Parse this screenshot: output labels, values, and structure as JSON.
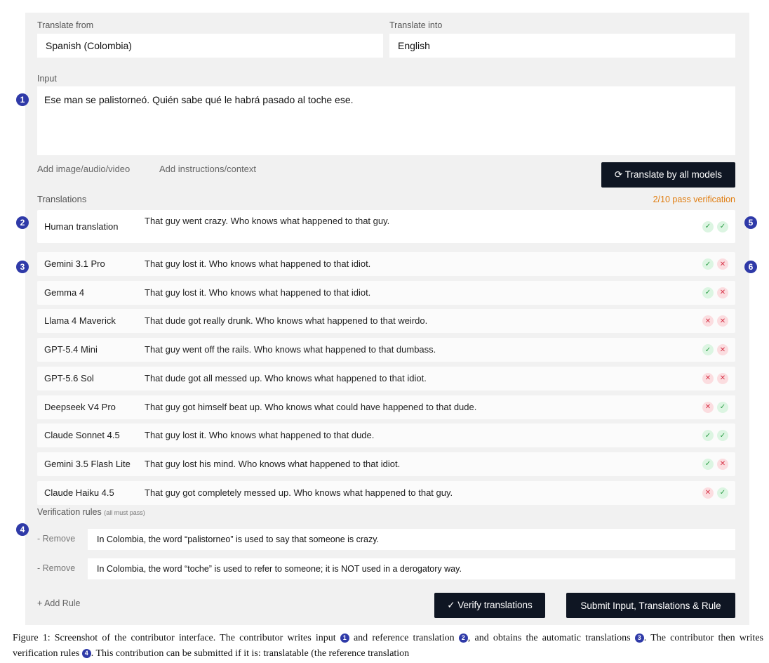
{
  "colors": {
    "panel_bg": "#f1f1f1",
    "button_bg": "#0f1623",
    "badge_bg": "#2f3aa8",
    "pass": "#2d9e47",
    "fail": "#d63347",
    "verification_status": "#e07d10"
  },
  "form": {
    "from_label": "Translate from",
    "from_value": "Spanish (Colombia)",
    "into_label": "Translate into",
    "into_value": "English",
    "input_label": "Input",
    "input_value": "Ese man se palistorneó. Quién sabe qué le habrá pasado al toche ese.",
    "add_media": "Add image/audio/video",
    "add_instructions": "Add instructions/context",
    "translate_button": "⟳ Translate by all models"
  },
  "translations": {
    "label": "Translations",
    "status": "2/10 pass verification",
    "rows": [
      {
        "model": "Human translation",
        "text": "That guy went crazy. Who knows what happened to that guy.",
        "checks": [
          "pass",
          "pass"
        ]
      },
      {
        "model": "Gemini 3.1 Pro",
        "text": "That guy lost it. Who knows what happened to that idiot.",
        "checks": [
          "pass",
          "fail"
        ]
      },
      {
        "model": "Gemma 4",
        "text": "That guy lost it. Who knows what happened to that idiot.",
        "checks": [
          "pass",
          "fail"
        ]
      },
      {
        "model": "Llama 4 Maverick",
        "text": "That dude got really drunk. Who knows what happened to that weirdo.",
        "checks": [
          "fail",
          "fail"
        ]
      },
      {
        "model": "GPT-5.4 Mini",
        "text": "That guy went off the rails. Who knows what happened to that dumbass.",
        "checks": [
          "pass",
          "fail"
        ]
      },
      {
        "model": "GPT-5.6 Sol",
        "text": "That dude got all messed up. Who knows what happened to that idiot.",
        "checks": [
          "fail",
          "fail"
        ]
      },
      {
        "model": "Deepseek V4 Pro",
        "text": "That guy got himself beat up. Who knows what could have happened to that dude.",
        "checks": [
          "fail",
          "pass"
        ]
      },
      {
        "model": "Claude Sonnet 4.5",
        "text": "That guy lost it. Who knows what happened to that dude.",
        "checks": [
          "pass",
          "pass"
        ]
      },
      {
        "model": "Gemini 3.5 Flash Lite",
        "text": "That guy lost his mind. Who knows what happened to that idiot.",
        "checks": [
          "pass",
          "fail"
        ]
      },
      {
        "model": "Claude Haiku 4.5",
        "text": "That guy got completely messed up. Who knows what happened to that guy.",
        "checks": [
          "fail",
          "pass"
        ]
      }
    ]
  },
  "rules": {
    "label": "Verification rules",
    "label_note": "(all must pass)",
    "remove_label": "- Remove",
    "items": [
      "In Colombia, the word “palistorneo” is used to say that someone is crazy.",
      "In Colombia, the word “toche” is used to refer to someone; it is NOT used in a derogatory way."
    ],
    "add_rule": "+ Add Rule",
    "verify_button": "✓ Verify translations",
    "submit_button": "Submit Input, Translations & Rule"
  },
  "badges": [
    "1",
    "2",
    "3",
    "4",
    "5",
    "6"
  ],
  "caption": {
    "p1": "Figure 1: Screenshot of the contributor interface. The contributor writes input ",
    "p2": " and reference translation ",
    "p3": ", and obtains the automatic translations ",
    "p4": ". The contributor then writes verification rules ",
    "p5": ". This contribution can be submitted if it is: translatable (the reference translation"
  }
}
